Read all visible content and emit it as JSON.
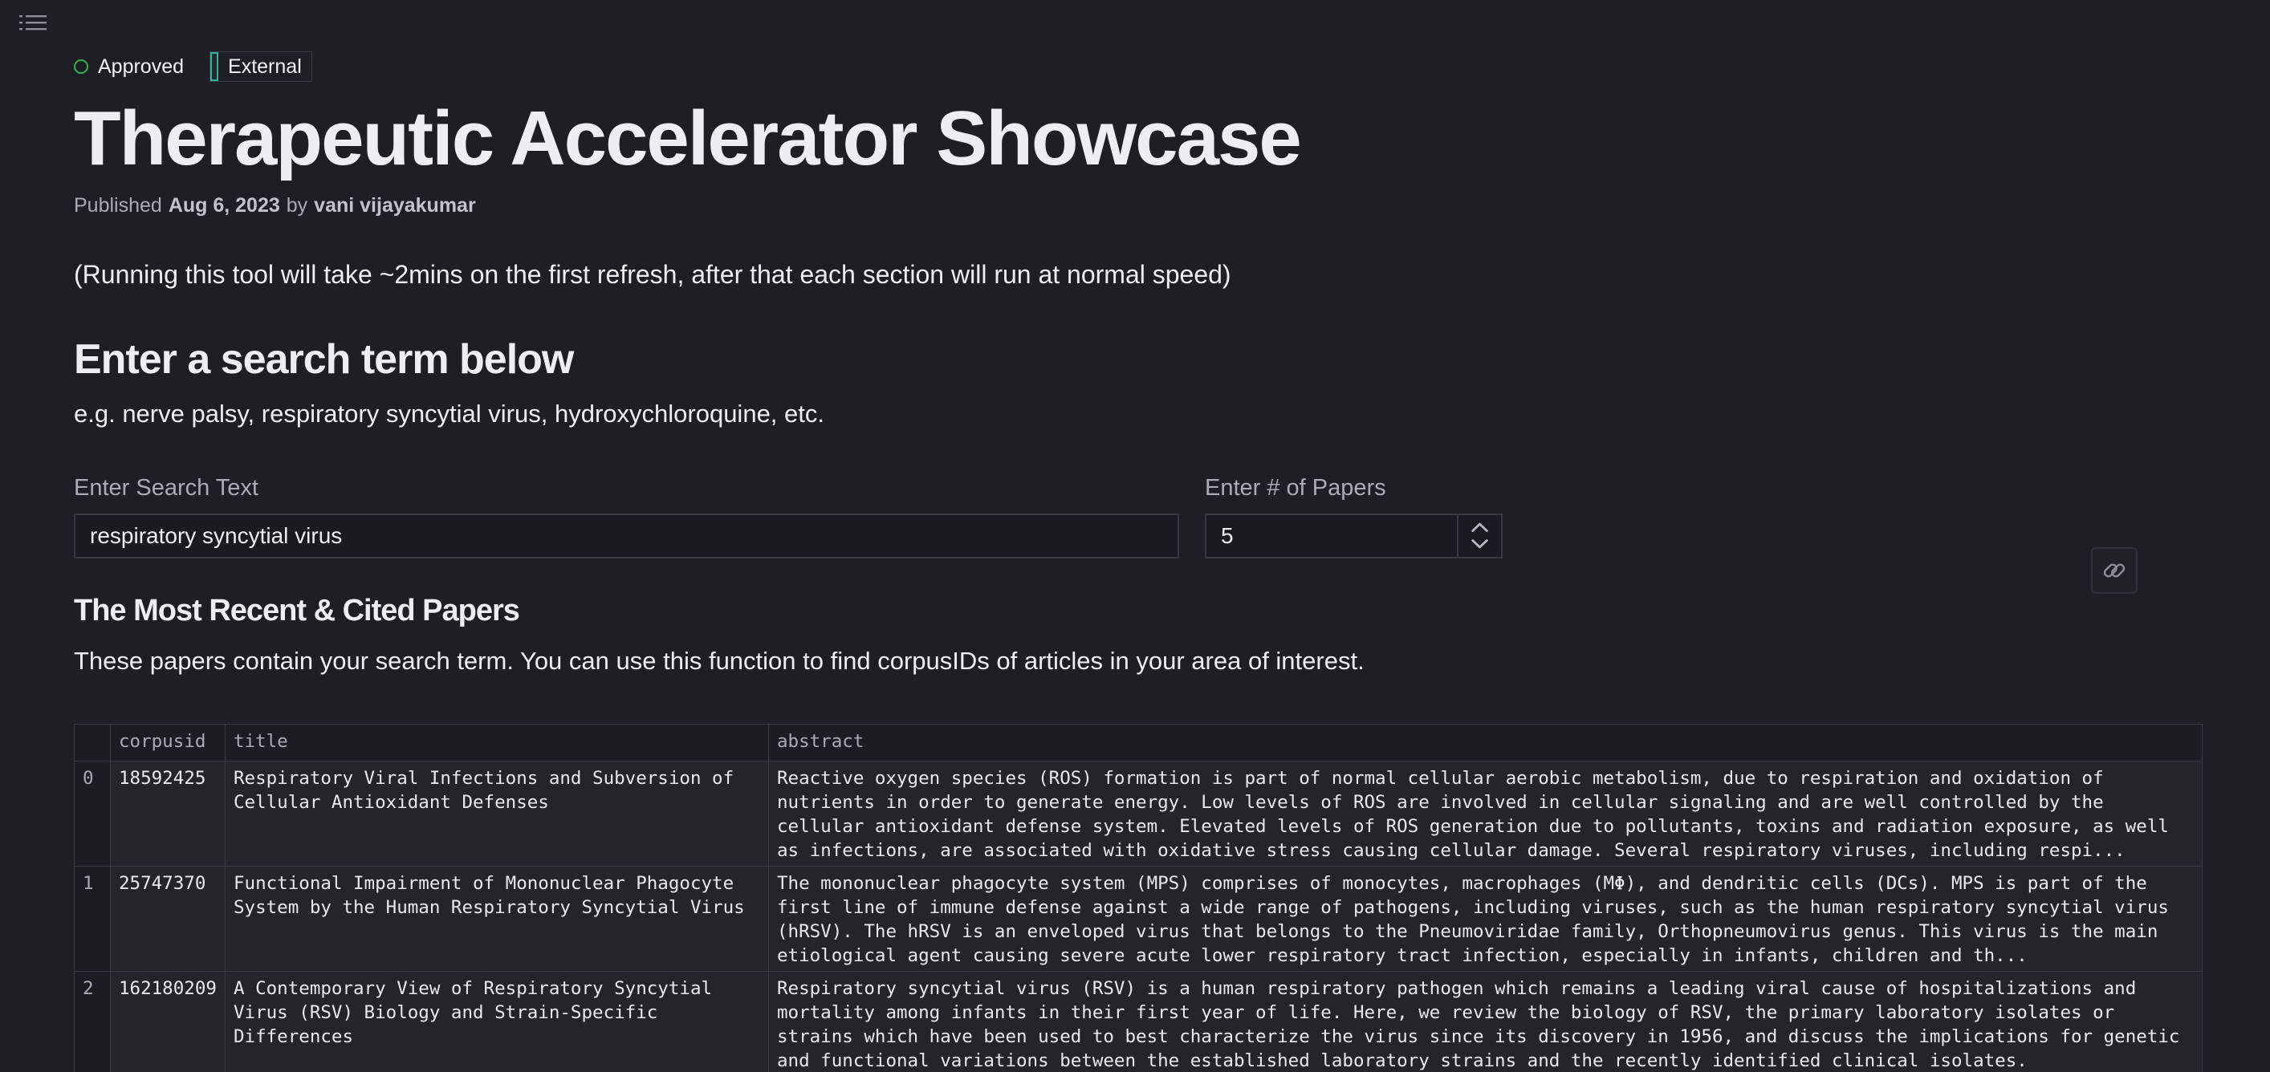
{
  "badges": {
    "approved": "Approved",
    "external": "External"
  },
  "page_title": "Therapeutic Accelerator Showcase",
  "byline": {
    "published_label": "Published",
    "date": "Aug 6, 2023",
    "by_label": "by",
    "author": "vani vijayakumar"
  },
  "note": "(Running this tool will take ~2mins on the first refresh, after that each section will run at normal speed)",
  "search_section": {
    "heading": "Enter a search term below",
    "examples": "e.g. nerve palsy, respiratory syncytial virus, hydroxychloroquine, etc.",
    "search_label": "Enter Search Text",
    "search_value": "respiratory syncytial virus",
    "papers_label": "Enter # of Papers",
    "papers_value": "5"
  },
  "results_section": {
    "heading": "The Most Recent & Cited Papers",
    "description": "These papers contain your search term. You can use this function to find corpusIDs of articles in your area of interest."
  },
  "table": {
    "columns": [
      "",
      "corpusid",
      "title",
      "abstract"
    ],
    "rows": [
      {
        "index": "0",
        "corpusid": "18592425",
        "title": "Respiratory Viral Infections and Subversion of Cellular Antioxidant Defenses",
        "abstract": "Reactive oxygen species (ROS) formation is part of normal cellular aerobic metabolism, due to respiration and oxidation of nutrients in order to generate energy. Low levels of ROS are involved in cellular signaling and are well controlled by the cellular antioxidant defense system. Elevated levels of ROS generation due to pollutants, toxins and radiation exposure, as well as infections, are associated with oxidative stress causing cellular damage. Several respiratory viruses, including respi..."
      },
      {
        "index": "1",
        "corpusid": "25747370",
        "title": "Functional Impairment of Mononuclear Phagocyte System by the Human Respiratory Syncytial Virus",
        "abstract": "The mononuclear phagocyte system (MPS) comprises of monocytes, macrophages (MΦ), and dendritic cells (DCs). MPS is part of the first line of immune defense against a wide range of pathogens, including viruses, such as the human respiratory syncytial virus (hRSV). The hRSV is an enveloped virus that belongs to the Pneumoviridae family, Orthopneumovirus genus. This virus is the main etiological agent causing severe acute lower respiratory tract infection, especially in infants, children and th..."
      },
      {
        "index": "2",
        "corpusid": "162180209",
        "title": "A Contemporary View of Respiratory Syncytial Virus (RSV) Biology and Strain-Specific Differences",
        "abstract": "Respiratory syncytial virus (RSV) is a human respiratory pathogen which remains a leading viral cause of hospitalizations and mortality among infants in their first year of life. Here, we review the biology of RSV, the primary laboratory isolates or strains which have been used to best characterize the virus since its discovery in 1956, and discuss the implications for genetic and functional variations between the established laboratory strains and the recently identified clinical isolates."
      }
    ]
  },
  "icons": {
    "toc": "table-of-contents-icon",
    "approved": "approved-status-dot",
    "external": "external-badge-bar",
    "stepper_up": "chevron-up-icon",
    "stepper_down": "chevron-down-icon",
    "link": "link-icon"
  },
  "colors": {
    "background": "#1e1f24",
    "approved": "#36b04a",
    "external": "#2fb4a4",
    "text": "#eceef2",
    "muted": "#a9acb4"
  }
}
